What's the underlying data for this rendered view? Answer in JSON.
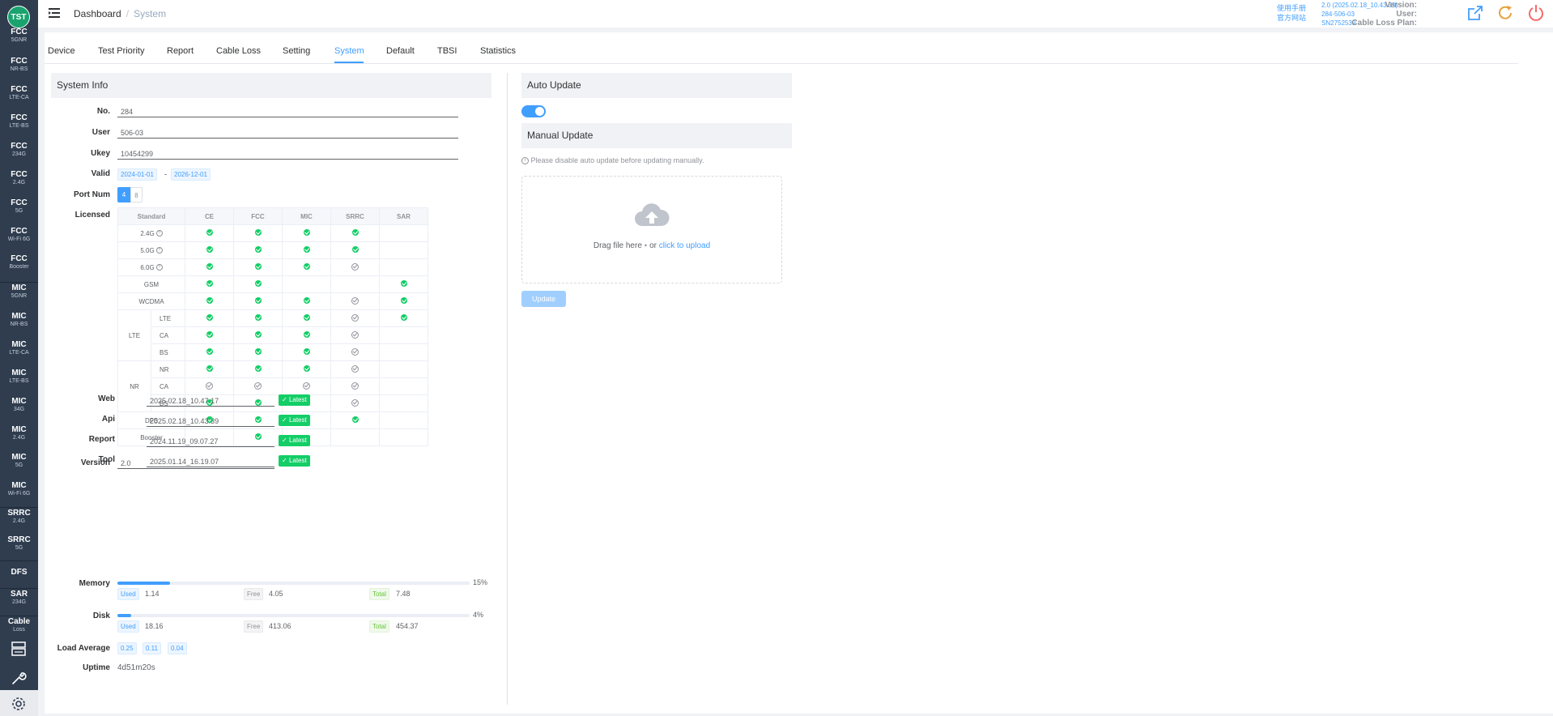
{
  "sidebar": {
    "logo": "TST",
    "items": [
      {
        "t1": "FCC",
        "t2": "5GNR"
      },
      {
        "t1": "FCC",
        "t2": "NR-BS"
      },
      {
        "t1": "FCC",
        "t2": "LTE-CA"
      },
      {
        "t1": "FCC",
        "t2": "LTE-BS"
      },
      {
        "t1": "FCC",
        "t2": "234G"
      },
      {
        "t1": "FCC",
        "t2": "2.4G"
      },
      {
        "t1": "FCC",
        "t2": "5G"
      },
      {
        "t1": "FCC",
        "t2": "Wi-Fi 6G"
      },
      {
        "t1": "FCC",
        "t2": "Booster"
      },
      {
        "t1": "MIC",
        "t2": "5GNR"
      },
      {
        "t1": "MIC",
        "t2": "NR-BS"
      },
      {
        "t1": "MIC",
        "t2": "LTE-CA"
      },
      {
        "t1": "MIC",
        "t2": "LTE-BS"
      },
      {
        "t1": "MIC",
        "t2": "34G"
      },
      {
        "t1": "MIC",
        "t2": "2.4G"
      },
      {
        "t1": "MIC",
        "t2": "5G"
      },
      {
        "t1": "MIC",
        "t2": "Wi-Fi 6G"
      },
      {
        "t1": "SRRC",
        "t2": "2.4G"
      },
      {
        "t1": "SRRC",
        "t2": "5G"
      },
      {
        "t1": "DFS",
        "t2": ""
      },
      {
        "t1": "SAR",
        "t2": "234G"
      },
      {
        "t1": "Cable",
        "t2": "Loss"
      }
    ]
  },
  "header": {
    "breadcrumb": [
      "Dashboard",
      "System"
    ],
    "links": [
      "使用手册",
      "官方网站"
    ],
    "info": [
      {
        "label": "Version:",
        "value": "2.0 (2025.02.18_10.43.39)"
      },
      {
        "label": "User:",
        "value": "284-506-03"
      },
      {
        "label": "Cable Loss Plan:",
        "value": "SN2752539"
      }
    ]
  },
  "tabs": [
    "Device",
    "Test Priority",
    "Report",
    "Cable Loss",
    "Setting",
    "System",
    "Default",
    "TBSI",
    "Statistics"
  ],
  "active_tab": "System",
  "system_info": {
    "title": "System Info",
    "no_label": "No.",
    "no_value": "284",
    "user_label": "User",
    "user_value": "506-03",
    "ukey_label": "Ukey",
    "ukey_value": "10454299",
    "valid_label": "Valid",
    "valid_from": "2024-01-01",
    "valid_dash": "-",
    "valid_to": "2026-12-01",
    "port_label": "Port Num",
    "port_options": [
      "4",
      "8"
    ],
    "port_selected": "4",
    "licensed_label": "Licensed",
    "table": {
      "headers": [
        "Standard",
        "CE",
        "FCC",
        "MIC",
        "SRRC",
        "SAR"
      ],
      "rows": [
        {
          "group": "",
          "name": "2.4G",
          "info": true,
          "cells": [
            "ok",
            "ok",
            "ok",
            "ok",
            ""
          ]
        },
        {
          "group": "",
          "name": "5.0G",
          "info": true,
          "cells": [
            "ok",
            "ok",
            "ok",
            "ok",
            ""
          ]
        },
        {
          "group": "",
          "name": "6.0G",
          "info": true,
          "cells": [
            "ok",
            "ok",
            "ok",
            "no",
            ""
          ]
        },
        {
          "group": "",
          "name": "GSM",
          "info": false,
          "cells": [
            "ok",
            "ok",
            "",
            "",
            "ok"
          ]
        },
        {
          "group": "",
          "name": "WCDMA",
          "info": false,
          "cells": [
            "ok",
            "ok",
            "ok",
            "no",
            "ok"
          ]
        },
        {
          "group": "LTE",
          "name": "LTE",
          "info": false,
          "cells": [
            "ok",
            "ok",
            "ok",
            "no",
            "ok"
          ]
        },
        {
          "group": "LTE",
          "name": "CA",
          "info": false,
          "cells": [
            "ok",
            "ok",
            "ok",
            "no",
            ""
          ]
        },
        {
          "group": "LTE",
          "name": "BS",
          "info": false,
          "cells": [
            "ok",
            "ok",
            "ok",
            "no",
            ""
          ]
        },
        {
          "group": "NR",
          "name": "NR",
          "info": false,
          "cells": [
            "ok",
            "ok",
            "ok",
            "no",
            ""
          ]
        },
        {
          "group": "NR",
          "name": "CA",
          "info": false,
          "cells": [
            "no",
            "no",
            "no",
            "no",
            ""
          ]
        },
        {
          "group": "NR",
          "name": "BS",
          "info": false,
          "cells": [
            "ok",
            "ok",
            "ok",
            "no",
            ""
          ]
        },
        {
          "group": "",
          "name": "DFS",
          "info": false,
          "cells": [
            "ok",
            "ok",
            "ok",
            "ok",
            ""
          ]
        },
        {
          "group": "",
          "name": "Booster",
          "info": false,
          "cells": [
            "",
            "ok",
            "",
            "",
            ""
          ]
        }
      ]
    },
    "version_label": "Version",
    "version_value": "2.0",
    "components": [
      {
        "label": "Web",
        "value": "2025.02.18_10.47.17",
        "status": "Latest"
      },
      {
        "label": "Api",
        "value": "2025.02.18_10.43.39",
        "status": "Latest"
      },
      {
        "label": "Report",
        "value": "2024.11.19_09.07.27",
        "status": "Latest"
      },
      {
        "label": "Tool",
        "value": "2025.01.14_16.19.07",
        "status": "Latest"
      }
    ],
    "memory": {
      "label": "Memory",
      "percent": 15,
      "percent_text": "15%",
      "used_tag": "Used",
      "used": "1.14",
      "free_tag": "Free",
      "free": "4.05",
      "total_tag": "Total",
      "total": "7.48"
    },
    "disk": {
      "label": "Disk",
      "percent": 4,
      "percent_text": "4%",
      "used_tag": "Used",
      "used": "18.16",
      "free_tag": "Free",
      "free": "413.06",
      "total_tag": "Total",
      "total": "454.37"
    },
    "load_label": "Load Average",
    "load": [
      "0.25",
      "0.11",
      "0.04"
    ],
    "uptime_label": "Uptime",
    "uptime": "4d51m20s"
  },
  "update": {
    "auto_title": "Auto Update",
    "auto_enabled": true,
    "manual_title": "Manual Update",
    "hint": "Please disable auto update before updating manually.",
    "drop_text": "Drag file here",
    "drop_or": "or",
    "drop_link": "click to upload",
    "button": "Update"
  },
  "colors": {
    "accent": "#409eff",
    "success": "#13ce66",
    "sidebar": "#2f3d4f"
  }
}
